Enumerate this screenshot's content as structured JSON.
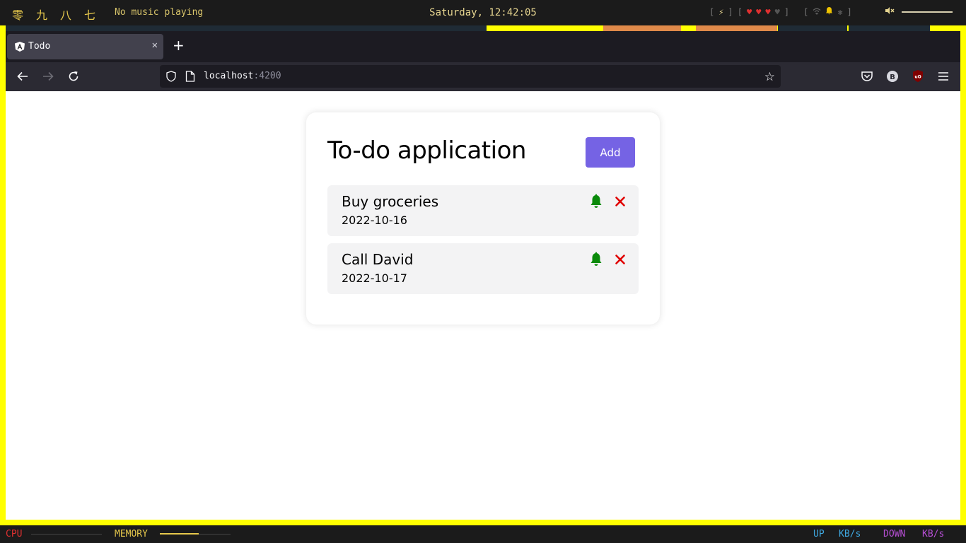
{
  "system_bar": {
    "workspaces": [
      "零",
      "九",
      "八",
      "七"
    ],
    "music_status": "No music playing",
    "clock": "Saturday, 12:42:05",
    "tray": {
      "open_bracket": "[",
      "close_bracket": "]",
      "hearts_full": 3,
      "hearts_total": 4
    },
    "volume_level": 1.0
  },
  "browser": {
    "tab": {
      "title": "Todo"
    },
    "new_tab_label": "+",
    "url": {
      "host": "localhost",
      "port": ":4200"
    }
  },
  "app": {
    "title": "To-do application",
    "add_button_label": "Add",
    "todos": [
      {
        "name": "Buy groceries",
        "date": "2022-10-16"
      },
      {
        "name": "Call David",
        "date": "2022-10-17"
      }
    ],
    "colors": {
      "accent": "#7563e4",
      "reminder": "#0a8a0a",
      "delete": "#e00000",
      "item_bg": "#f3f3f4"
    }
  },
  "status_bar": {
    "cpu_label": "CPU",
    "memory_label": "MEMORY",
    "memory_usage": 0.55,
    "up_label": "UP",
    "up_unit": "KB/s",
    "down_label": "DOWN",
    "down_unit": "KB/s"
  },
  "icons": [
    "angular-icon",
    "close-icon",
    "back-icon",
    "forward-icon",
    "reload-icon",
    "shield-icon",
    "page-icon",
    "star-icon",
    "pocket-icon",
    "bitwarden-icon",
    "ublock-icon",
    "menu-icon",
    "bell-icon",
    "delete-icon",
    "volume-muted-icon"
  ]
}
